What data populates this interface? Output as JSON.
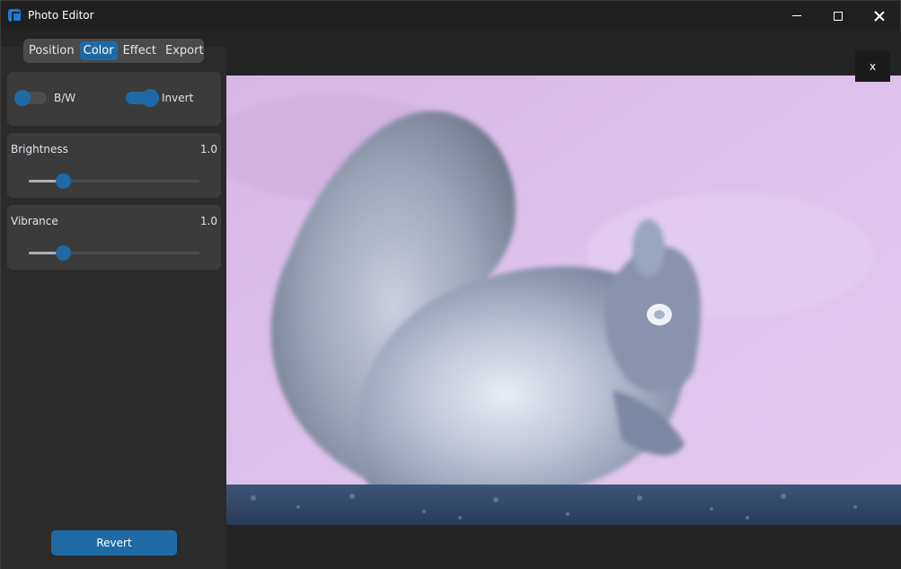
{
  "window": {
    "title": "Photo Editor",
    "controls": {
      "minimize": "minimize-icon",
      "maximize": "maximize-icon",
      "close": "close-icon"
    }
  },
  "sidebar": {
    "tabs": [
      {
        "label": "Position",
        "active": false
      },
      {
        "label": "Color",
        "active": true
      },
      {
        "label": "Effect",
        "active": false
      },
      {
        "label": "Export",
        "active": false
      }
    ],
    "toggles": {
      "bw": {
        "label": "B/W",
        "on": false
      },
      "invert": {
        "label": "Invert",
        "on": true
      }
    },
    "brightness": {
      "label": "Brightness",
      "value": "1.0",
      "level": 0.2
    },
    "vibrance": {
      "label": "Vibrance",
      "value": "1.0",
      "level": 0.2
    },
    "revert_label": "Revert"
  },
  "canvas": {
    "close_label": "x",
    "image_description_icon": "photo-squirrel-inverted"
  },
  "colors": {
    "accent": "#1f6aa5",
    "background": "#242424",
    "panel": "#3b3b3b",
    "sidebar": "#2b2b2b"
  }
}
